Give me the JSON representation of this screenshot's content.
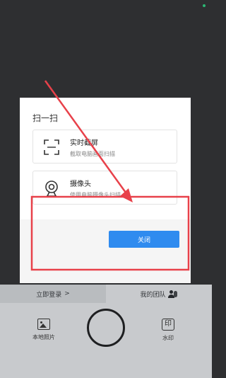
{
  "dialog": {
    "title": "扫一扫",
    "options": [
      {
        "title": "实时截屏",
        "description": "截取电脑画面扫描",
        "icon": "scan-frame-icon"
      },
      {
        "title": "摄像头",
        "description": "使用电脑摄像头扫描",
        "icon": "webcam-icon"
      }
    ],
    "close_label": "关闭"
  },
  "bottom_bar": {
    "login_label": "立即登录",
    "login_chevron": ">",
    "team_label": "我的团队",
    "local_photos_label": "本地照片",
    "watermark_label": "水印",
    "watermark_glyph": "印"
  },
  "colors": {
    "background": "#2e2f31",
    "primary_button": "#2f8bef",
    "annotation_red": "#e8414a",
    "bottom_bar": "#c8cacd"
  }
}
